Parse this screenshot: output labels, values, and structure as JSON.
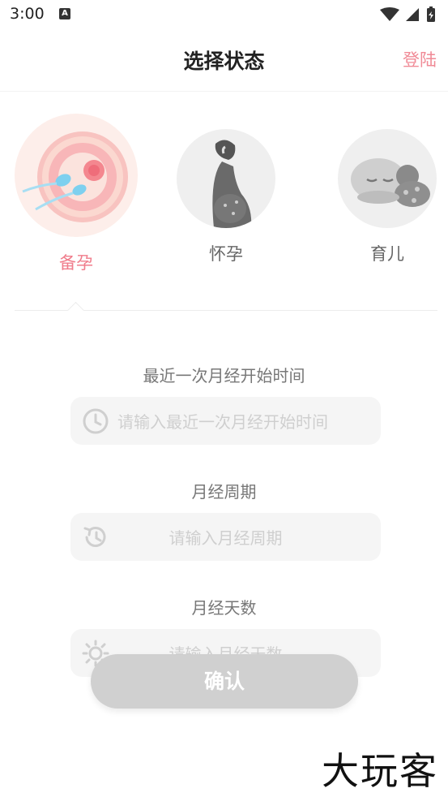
{
  "status_bar": {
    "time": "3:00",
    "notification_badge": "A"
  },
  "header": {
    "title": "选择状态",
    "login_label": "登陆"
  },
  "options": [
    {
      "label": "备孕",
      "icon": "egg-sperm-illustration",
      "active": true
    },
    {
      "label": "怀孕",
      "icon": "pregnant-woman-illustration",
      "active": false
    },
    {
      "label": "育儿",
      "icon": "sleeping-baby-illustration",
      "active": false
    }
  ],
  "form": {
    "last_period": {
      "label": "最近一次月经开始时间",
      "placeholder": "请输入最近一次月经开始时间",
      "icon": "clock-icon"
    },
    "cycle": {
      "label": "月经周期",
      "placeholder": "请输入月经周期",
      "icon": "history-icon"
    },
    "days": {
      "label": "月经天数",
      "placeholder": "请输入月经天数",
      "icon": "sun-icon"
    }
  },
  "confirm_label": "确认",
  "watermark": "大玩客",
  "colors": {
    "accent": "#f07d8c",
    "login": "#f08a96",
    "button_disabled": "#d0d0d0",
    "field_bg": "#f5f5f5"
  }
}
